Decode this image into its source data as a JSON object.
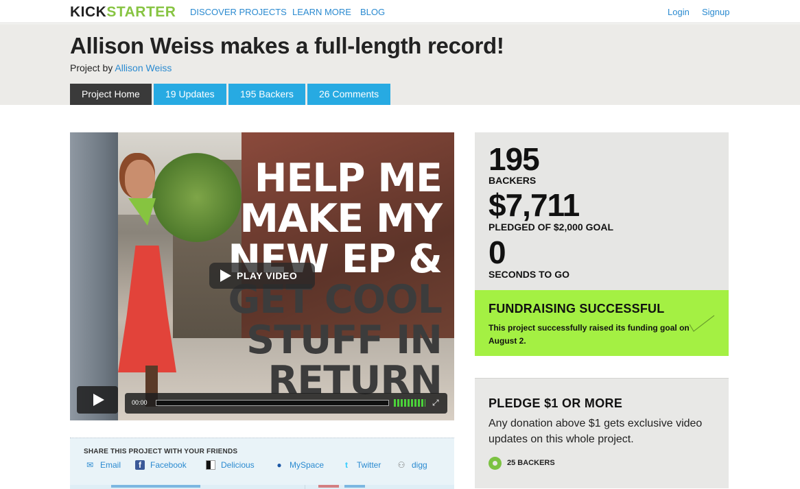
{
  "nav": {
    "logo_kick": "KICK",
    "logo_starter": "STARTER",
    "links": [
      "DISCOVER PROJECTS",
      "LEARN MORE",
      "BLOG"
    ],
    "login": "Login",
    "signup": "Signup"
  },
  "project": {
    "title": "Allison Weiss makes a full-length record!",
    "by_prefix": "Project by",
    "creator": "Allison Weiss"
  },
  "tabs": [
    "Project Home",
    "19 Updates",
    "195 Backers",
    "26 Comments"
  ],
  "video": {
    "overlay_lines": [
      "HELP ME",
      "MAKE MY",
      "NEW EP &",
      "GET COOL",
      "STUFF IN",
      "RETURN"
    ],
    "play_label": "PLAY VIDEO",
    "time": "00:00"
  },
  "share": {
    "heading": "SHARE THIS PROJECT WITH YOUR FRIENDS",
    "items": [
      {
        "label": "Email",
        "icon": "email-icon"
      },
      {
        "label": "Facebook",
        "icon": "facebook-icon"
      },
      {
        "label": "Delicious",
        "icon": "delicious-icon"
      },
      {
        "label": "MySpace",
        "icon": "myspace-icon"
      },
      {
        "label": "Twitter",
        "icon": "twitter-icon"
      },
      {
        "label": "digg",
        "icon": "digg-icon"
      }
    ]
  },
  "stats": {
    "backers_value": "195",
    "backers_label": "BACKERS",
    "pledged_value": "$7,711",
    "pledged_label": "PLEDGED OF $2,000 GOAL",
    "time_value": "0",
    "time_label": "SECONDS TO GO"
  },
  "status": {
    "title": "FUNDRAISING SUCCESSFUL",
    "text": "This project successfully raised its funding goal on August 2."
  },
  "reward": {
    "title": "PLEDGE $1 OR MORE",
    "description": "Any donation above $1 gets exclusive video updates on this whole project.",
    "backers": "25 BACKERS"
  },
  "colors": {
    "accent_blue": "#27aae2",
    "link_blue": "#2a8ad0",
    "success_green": "#a4f043",
    "brand_green": "#87c442"
  }
}
